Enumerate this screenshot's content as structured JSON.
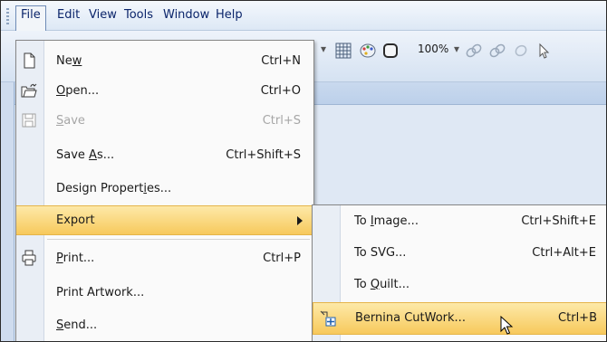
{
  "menubar": {
    "items": [
      "File",
      "Edit",
      "View",
      "Tools",
      "Window",
      "Help"
    ]
  },
  "toolbar": {
    "zoom": "100%"
  },
  "file_menu": {
    "items": [
      {
        "pre": "Ne",
        "u": "w",
        "post": "",
        "shortcut": "Ctrl+N",
        "icon": "new-document-icon"
      },
      {
        "pre": "",
        "u": "O",
        "post": "pen...",
        "shortcut": "Ctrl+O",
        "icon": "open-folder-icon"
      },
      {
        "pre": "",
        "u": "S",
        "post": "ave",
        "shortcut": "Ctrl+S",
        "icon": "save-disk-icon",
        "disabled": true
      },
      {
        "pre": "Save ",
        "u": "A",
        "post": "s...",
        "shortcut": "Ctrl+Shift+S"
      },
      {
        "pre": "Design Propert",
        "u": "i",
        "post": "es...",
        "shortcut": ""
      },
      {
        "pre": "Export",
        "u": "",
        "post": "",
        "shortcut": ""
      },
      {
        "pre": "",
        "u": "P",
        "post": "rint...",
        "shortcut": "Ctrl+P",
        "icon": "printer-icon"
      },
      {
        "pre": "Print Artwork...",
        "u": "",
        "post": "",
        "shortcut": ""
      },
      {
        "pre": "",
        "u": "S",
        "post": "end...",
        "shortcut": ""
      }
    ]
  },
  "export_submenu": {
    "items": [
      {
        "pre": "To ",
        "u": "I",
        "post": "mage...",
        "shortcut": "Ctrl+Shift+E"
      },
      {
        "pre": "To SVG...",
        "u": "",
        "post": "",
        "shortcut": "Ctrl+Alt+E"
      },
      {
        "pre": "To ",
        "u": "Q",
        "post": "uilt...",
        "shortcut": ""
      },
      {
        "pre": "Bernina CutWork...",
        "u": "",
        "post": "",
        "shortcut": "Ctrl+B",
        "icon": "cutwork-icon"
      }
    ]
  }
}
